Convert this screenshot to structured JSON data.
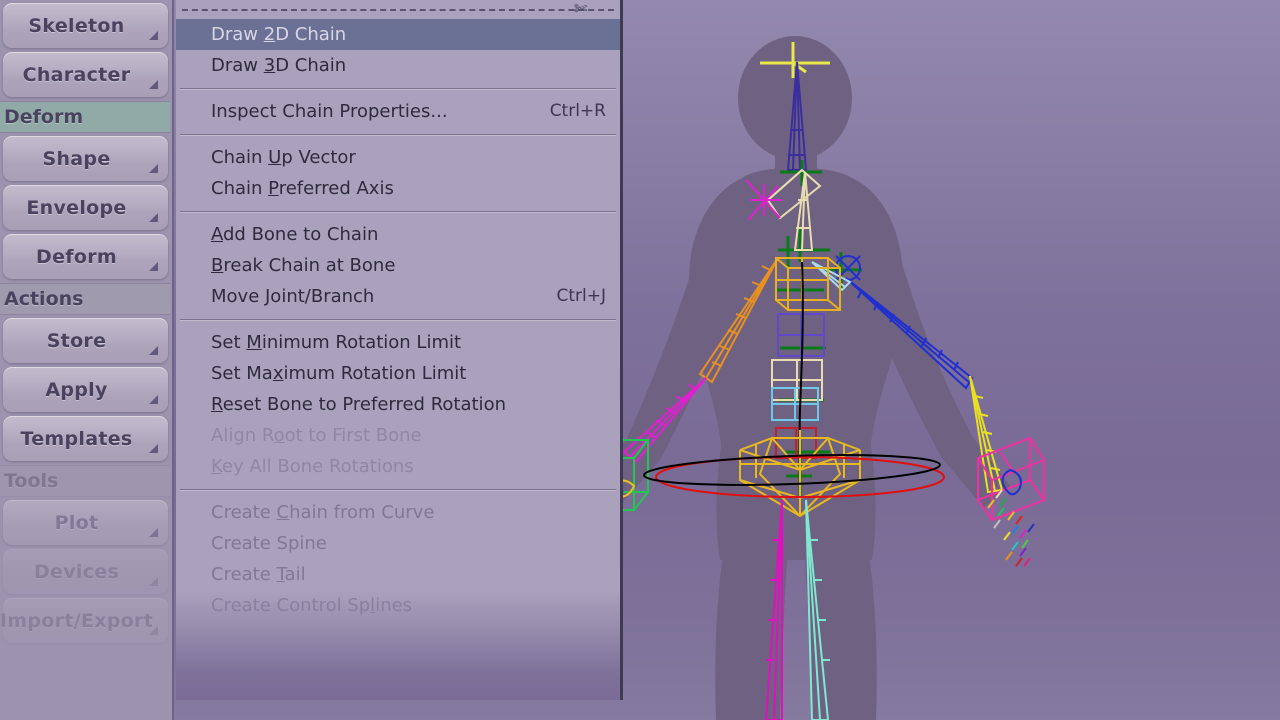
{
  "app": {
    "background_top": "#9388ad",
    "background_bottom": "#857a9f",
    "body_color": "#6e6181",
    "menu_bg": "#aaa2bc",
    "menu_border": "#3e3a52",
    "highlight_bg": "#6b7095",
    "highlight_fg": "#d8d6e6",
    "sidebar_bg": "#9c94ae",
    "header_teal": "#92aaa7",
    "header_grey": "#a09aae"
  },
  "sidebar": {
    "items": [
      {
        "type": "button",
        "label": "Skeleton",
        "state": "normal",
        "arrow": "corner-arrow-icon"
      },
      {
        "type": "button",
        "label": "Character",
        "state": "normal",
        "arrow": "corner-arrow-icon"
      },
      {
        "type": "header",
        "label": "Deform",
        "style": "teal"
      },
      {
        "type": "button",
        "label": "Shape",
        "state": "normal",
        "arrow": "corner-arrow-icon"
      },
      {
        "type": "button",
        "label": "Envelope",
        "state": "normal",
        "arrow": "corner-arrow-icon"
      },
      {
        "type": "button",
        "label": "Deform",
        "state": "normal",
        "arrow": "corner-arrow-icon"
      },
      {
        "type": "header",
        "label": "Actions",
        "style": "grey"
      },
      {
        "type": "button",
        "label": "Store",
        "state": "normal",
        "arrow": "corner-arrow-icon"
      },
      {
        "type": "button",
        "label": "Apply",
        "state": "normal",
        "arrow": "corner-arrow-icon"
      },
      {
        "type": "button",
        "label": "Templates",
        "state": "normal",
        "arrow": "corner-arrow-icon"
      },
      {
        "type": "header",
        "label": "Tools",
        "style": "grey"
      },
      {
        "type": "button",
        "label": "Plot",
        "state": "dim",
        "arrow": "corner-arrow-icon"
      },
      {
        "type": "button",
        "label": "Devices",
        "state": "dim",
        "arrow": "corner-arrow-icon"
      },
      {
        "type": "button",
        "label": "Import/Export",
        "state": "fading",
        "arrow": "corner-arrow-icon"
      }
    ]
  },
  "menu": {
    "tearoff": {
      "icon": "scissors-icon",
      "label": ""
    },
    "items": [
      {
        "kind": "item",
        "label": "Draw 2D Chain",
        "mnemonic": "2",
        "accel": "",
        "state": "selected"
      },
      {
        "kind": "item",
        "label": "Draw 3D Chain",
        "mnemonic": "3",
        "accel": "",
        "state": "enabled"
      },
      {
        "kind": "separator"
      },
      {
        "kind": "item",
        "label": "Inspect Chain Properties...",
        "mnemonic": "",
        "accel": "Ctrl+R",
        "state": "enabled"
      },
      {
        "kind": "separator"
      },
      {
        "kind": "item",
        "label": "Chain Up Vector",
        "mnemonic": "U",
        "accel": "",
        "state": "enabled"
      },
      {
        "kind": "item",
        "label": "Chain Preferred Axis",
        "mnemonic": "P",
        "accel": "",
        "state": "enabled"
      },
      {
        "kind": "separator"
      },
      {
        "kind": "item",
        "label": "Add Bone to Chain",
        "mnemonic": "A",
        "accel": "",
        "state": "enabled"
      },
      {
        "kind": "item",
        "label": "Break Chain at Bone",
        "mnemonic": "B",
        "accel": "",
        "state": "enabled"
      },
      {
        "kind": "item",
        "label": "Move Joint/Branch",
        "mnemonic": "",
        "accel": "Ctrl+J",
        "state": "enabled"
      },
      {
        "kind": "separator"
      },
      {
        "kind": "item",
        "label": "Set Minimum Rotation Limit",
        "mnemonic": "M",
        "accel": "",
        "state": "enabled"
      },
      {
        "kind": "item",
        "label": "Set Maximum Rotation Limit",
        "mnemonic": "x",
        "accel": "",
        "state": "enabled"
      },
      {
        "kind": "item",
        "label": "Reset Bone to Preferred Rotation",
        "mnemonic": "R",
        "accel": "",
        "state": "enabled"
      },
      {
        "kind": "item",
        "label": "Align Root to First Bone",
        "mnemonic": "o",
        "accel": "",
        "state": "enabled"
      },
      {
        "kind": "item",
        "label": "Key All Bone Rotations",
        "mnemonic": "K",
        "accel": "",
        "state": "enabled"
      },
      {
        "kind": "separator"
      },
      {
        "kind": "item",
        "label": "Create Chain from Curve",
        "mnemonic": "C",
        "accel": "",
        "state": "disabled"
      },
      {
        "kind": "item",
        "label": "Create Spine",
        "mnemonic": "",
        "accel": "",
        "state": "disabled"
      },
      {
        "kind": "item",
        "label": "Create Tail",
        "mnemonic": "T",
        "accel": "",
        "state": "disabled"
      },
      {
        "kind": "item",
        "label": "Create Control Splines",
        "mnemonic": "l",
        "accel": "",
        "state": "disabled"
      }
    ]
  },
  "viewport": {
    "name": "3d-character-rig-viewport",
    "rig_colors": {
      "head_root_cross": "#e8e84a",
      "neck_chain": "#3b2f9e",
      "clavicle": "#e8d9a8",
      "left_arm": "#e89020",
      "right_arm": "#2030d0",
      "right_forearm": "#e8e020",
      "left_forearm": "#e020d0",
      "spine_boxes_orange": "#e8b020",
      "spine_boxes_violet": "#6048c8",
      "spine_boxes_cream": "#e8dcb0",
      "spine_boxes_cyan": "#70c8e8",
      "spine_boxes_red": "#c02030",
      "hip_cage": "#e8b820",
      "hip_ellipse_red": "#e01010",
      "hip_ellipse_black": "#000000",
      "leg_magenta": "#e010c0",
      "leg_cyan": "#80e8d0",
      "hand_box_left": "#20c850",
      "hand_box_right": "#f030a0",
      "effector_green": "#0a7a18",
      "effector_magenta": "#e020d0"
    }
  }
}
